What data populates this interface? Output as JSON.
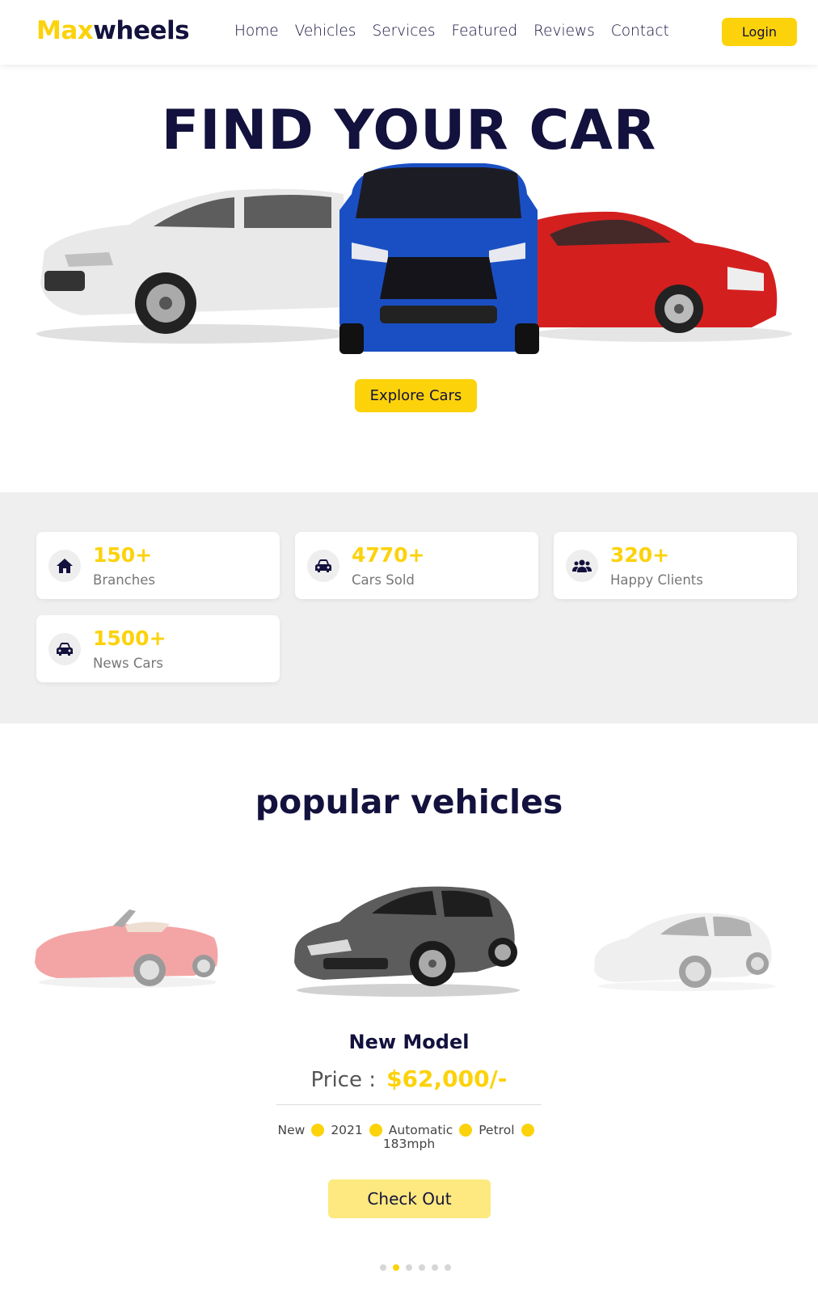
{
  "header": {
    "logo_part1": "Max",
    "logo_part2": "wheels",
    "nav": [
      "Home",
      "Vehicles",
      "Services",
      "Featured",
      "Reviews",
      "Contact"
    ],
    "login_label": "Login"
  },
  "hero": {
    "title": "FIND YOUR CAR",
    "explore_label": "Explore Cars"
  },
  "stats": [
    {
      "value": "150+",
      "label": "Branches",
      "icon": "home-icon"
    },
    {
      "value": "4770+",
      "label": "Cars Sold",
      "icon": "car-icon"
    },
    {
      "value": "320+",
      "label": "Happy Clients",
      "icon": "users-icon"
    },
    {
      "value": "1500+",
      "label": "News Cars",
      "icon": "car-icon"
    }
  ],
  "popular": {
    "title_part1": "popular",
    "title_part2": "vehicles",
    "model_name": "New Model",
    "price_label": "Price :",
    "price_value": "$62,000/-",
    "specs": [
      "New",
      "2021",
      "Automatic",
      "Petrol",
      "183mph"
    ],
    "checkout_label": "Check Out",
    "pagination_count": 6,
    "active_page": 2
  },
  "colors": {
    "accent": "#fcd20a",
    "navy": "#13113d",
    "stats_bg": "#efefef"
  }
}
